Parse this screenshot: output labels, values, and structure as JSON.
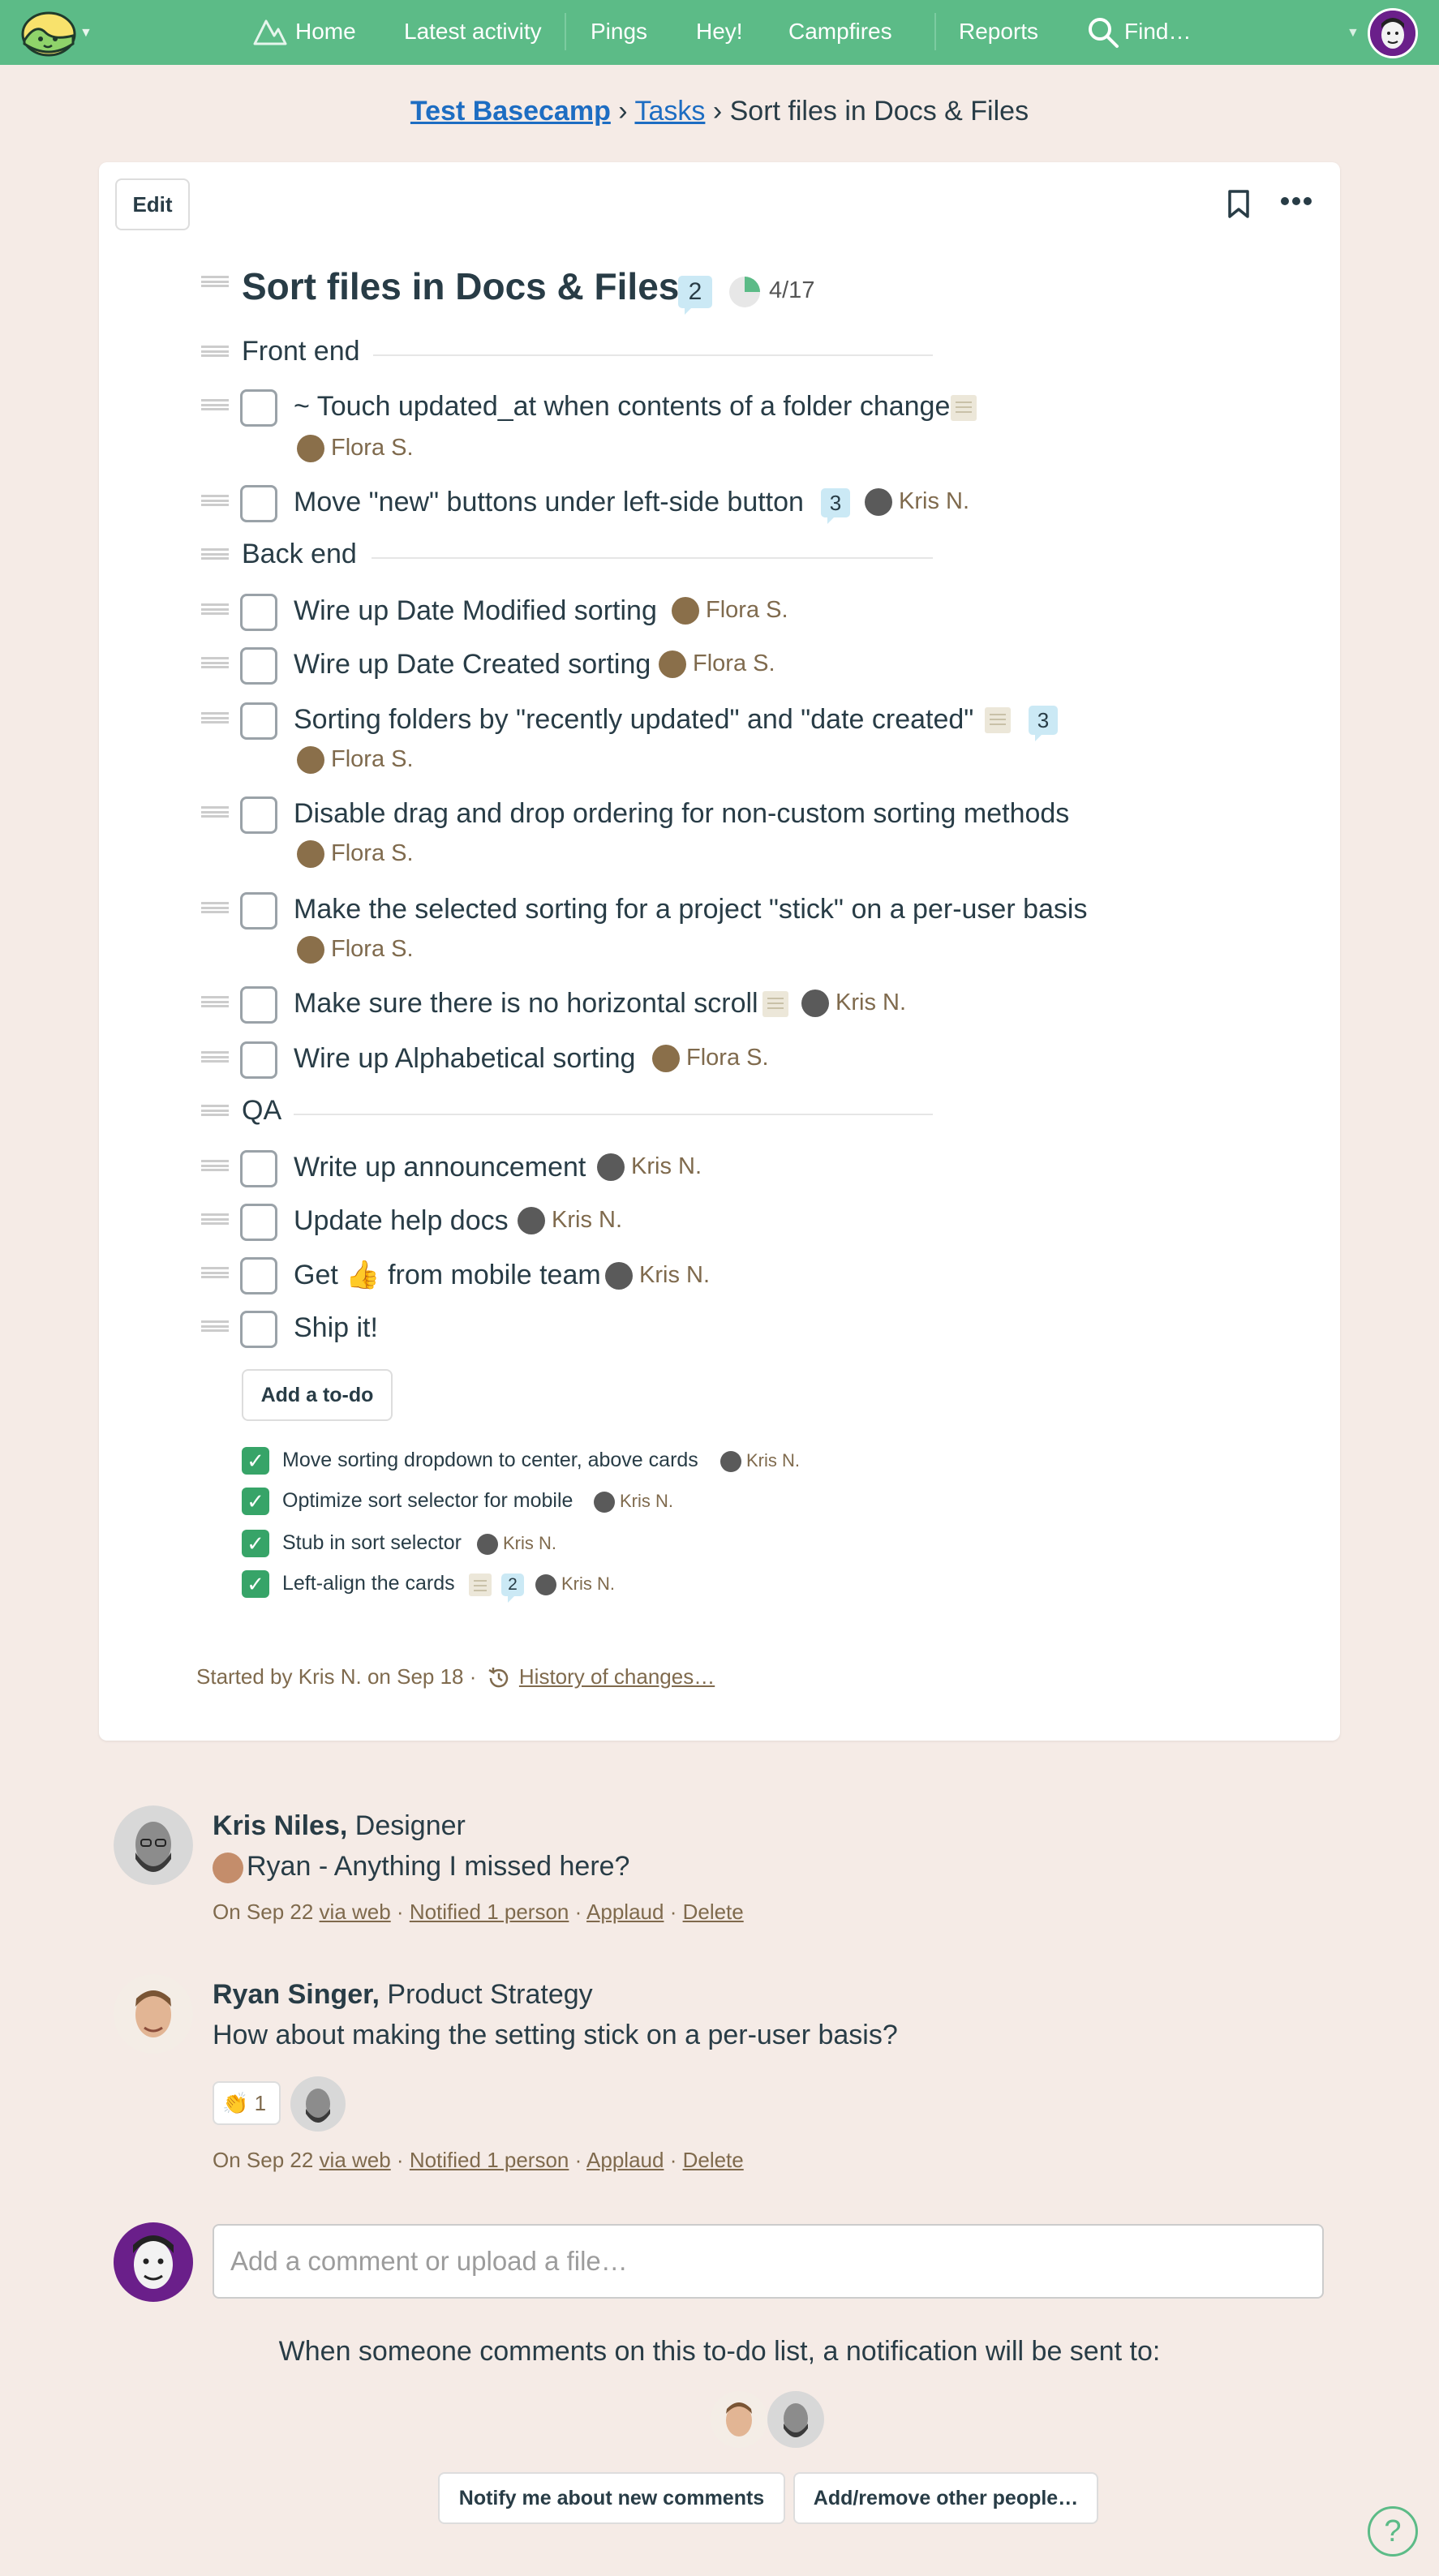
{
  "nav": {
    "items": [
      "Home",
      "Latest activity",
      "Pings",
      "Hey!",
      "Campfires",
      "Reports",
      "Find…"
    ]
  },
  "breadcrumb": {
    "project": "Test Basecamp",
    "sep1": "›",
    "tool": "Tasks",
    "sep2": "›",
    "current": "Sort files in Docs & Files"
  },
  "list": {
    "edit_label": "Edit",
    "title": "Sort files in Docs & Files",
    "comment_count": "2",
    "progress": "4/17",
    "progress_fraction": 0.235,
    "sections": [
      "Front end",
      "Back end",
      "QA"
    ],
    "todos": [
      {
        "text": "~ Touch updated_at when contents of a folder change",
        "assignee": "Flora S."
      },
      {
        "text": "Move \"new\" buttons under left-side button",
        "count": "3",
        "assignee": "Kris N."
      },
      {
        "text": "Wire up Date Modified sorting",
        "assignee": "Flora S."
      },
      {
        "text": "Wire up Date Created sorting",
        "assignee": "Flora S."
      },
      {
        "text": "Sorting folders by \"recently updated\" and \"date created\"",
        "count": "3",
        "assignee": "Flora S."
      },
      {
        "text": "Disable drag and drop ordering for non-custom sorting methods",
        "assignee": "Flora S."
      },
      {
        "text": "Make the selected sorting for a project \"stick\" on a per-user basis",
        "assignee": "Flora S."
      },
      {
        "text": "Make sure there is no horizontal scroll",
        "assignee": "Kris N."
      },
      {
        "text": "Wire up Alphabetical sorting",
        "assignee": "Flora S."
      },
      {
        "text": "Write up announcement",
        "assignee": "Kris N."
      },
      {
        "text": "Update help docs",
        "assignee": "Kris N."
      },
      {
        "text_before": "Get",
        "emoji": "👍",
        "text_after": "from mobile team",
        "assignee": "Kris N."
      },
      {
        "text": "Ship it!"
      }
    ],
    "add_todo_label": "Add a to-do",
    "completed": [
      {
        "text": "Move sorting dropdown to center, above cards",
        "assignee": "Kris N."
      },
      {
        "text": "Optimize sort selector for mobile",
        "assignee": "Kris N."
      },
      {
        "text": "Stub in sort selector",
        "assignee": "Kris N."
      },
      {
        "text": "Left-align the cards",
        "count": "2",
        "assignee": "Kris N."
      }
    ],
    "started_by": "Started by Kris N. on Sep 18",
    "dot": "·",
    "history_label": "History of changes…"
  },
  "comments": [
    {
      "name": "Kris Niles,",
      "role": "Designer",
      "body": "Ryan - Anything I missed here?",
      "date": "On Sep 22",
      "via": "via web",
      "notified": "Notified 1 person",
      "applaud": "Applaud",
      "delete": "Delete"
    },
    {
      "name": "Ryan Singer,",
      "role": "Product Strategy",
      "body": "How about making the setting stick on a per-user basis?",
      "clap_emoji": "👏",
      "clap_count": "1",
      "date": "On Sep 22",
      "via": "via web",
      "notified": "Notified 1 person",
      "applaud": "Applaud",
      "delete": "Delete"
    }
  ],
  "composer": {
    "placeholder": "Add a comment or upload a file…"
  },
  "notify": {
    "text": "When someone comments on this to-do list, a notification will be sent to:",
    "notify_me_label": "Notify me about new comments",
    "add_remove_label": "Add/remove other people…"
  },
  "help_label": "?",
  "colors": {
    "brand": "#5cbb87",
    "link": "#1d6dc2",
    "background": "#f5ebe6",
    "check": "#37a468"
  }
}
